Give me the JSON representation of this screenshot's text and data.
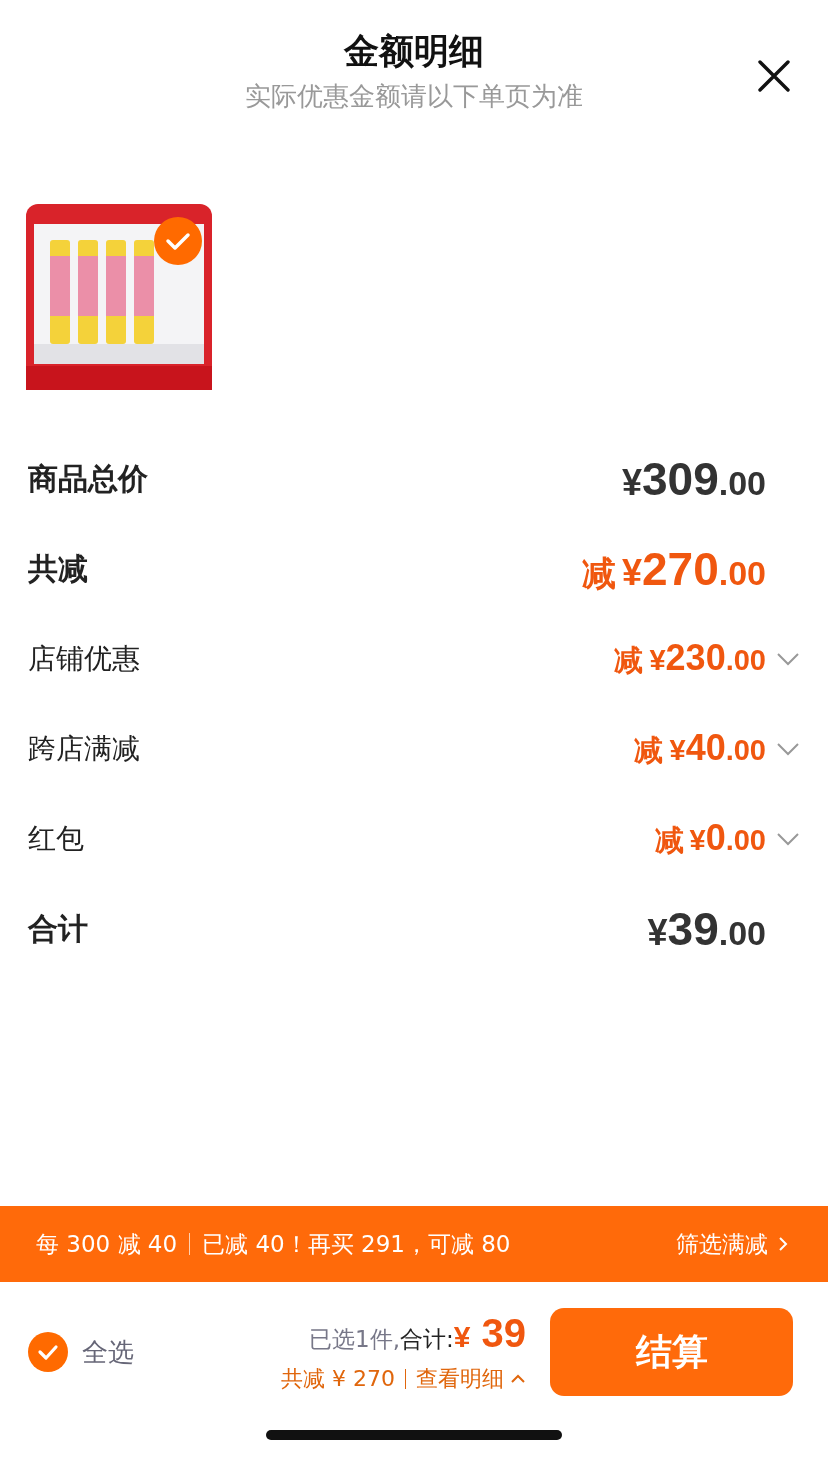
{
  "header": {
    "title": "金额明细",
    "subtitle": "实际优惠金额请以下单页为准"
  },
  "products": [
    {
      "kind": "picture",
      "selected": true
    }
  ],
  "rows": [
    {
      "kind": "main",
      "label": "商品总价",
      "amount": "¥309",
      "decimals": ".00"
    },
    {
      "kind": "saving",
      "label": "共减",
      "prefix": "减",
      "amount": "¥270",
      "decimals": ".00"
    },
    {
      "kind": "detail",
      "label": "店铺优惠",
      "prefix": "减",
      "amount": "¥230",
      "decimals": ".00"
    },
    {
      "kind": "detail",
      "label": "跨店满减",
      "prefix": "减",
      "amount": "¥40",
      "decimals": ".00"
    },
    {
      "kind": "detail",
      "label": "红包",
      "prefix": "减",
      "amount": "¥0",
      "decimals": ".00"
    },
    {
      "kind": "main",
      "label": "合计",
      "amount": "¥39",
      "decimals": ".00"
    }
  ],
  "promo": {
    "rule": "每 300 减 40",
    "progress": "已减 40！再买 291，可减 80",
    "link": "筛选满减"
  },
  "footer": {
    "select_all": {
      "label": "全选",
      "checked": true
    },
    "selected_count": "已选1件,",
    "total_label": "合计:",
    "currency": "¥",
    "total": "39",
    "saved": "共减 ¥ 270",
    "details_link": "查看明细",
    "details_expanded": false,
    "checkout": "结算"
  }
}
